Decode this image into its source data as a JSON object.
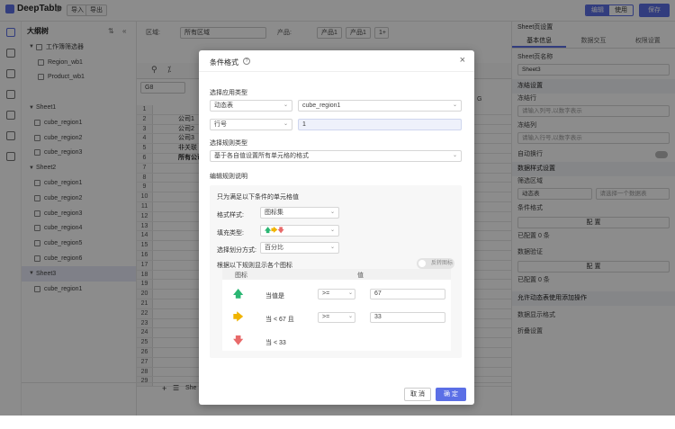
{
  "app": {
    "name": "DeepTable",
    "import": "导入",
    "export": "导出",
    "mode_edit": "编辑",
    "mode_use": "使用",
    "save": "保存"
  },
  "tree": {
    "title": "大纲树",
    "filters_group": "工作簿筛选器",
    "filters": [
      "Region_wb1",
      "Product_wb1"
    ],
    "sheets": [
      {
        "name": "Sheet1",
        "items": [
          "cube_region1",
          "cube_region2",
          "cube_region3"
        ]
      },
      {
        "name": "Sheet2",
        "items": [
          "cube_region1",
          "cube_region2",
          "cube_region3",
          "cube_region4",
          "cube_region5",
          "cube_region6"
        ]
      },
      {
        "name": "Sheet3",
        "items": [
          "cube_region1"
        ]
      }
    ]
  },
  "main": {
    "filter_region_label": "区域:",
    "filter_region_value": "所有区域",
    "filter_product_label": "产品:",
    "product_tags": [
      "产品1",
      "产品1",
      "1+"
    ],
    "col_header": "G",
    "cell_ref": "G8",
    "rows": [
      {
        "n": "1",
        "t": ""
      },
      {
        "n": "2",
        "t": "公司1"
      },
      {
        "n": "3",
        "t": "公司2"
      },
      {
        "n": "4",
        "t": "公司3"
      },
      {
        "n": "5",
        "t": "非关联"
      },
      {
        "n": "6",
        "t": "所有公司"
      },
      {
        "n": "7",
        "t": ""
      },
      {
        "n": "8",
        "t": ""
      },
      {
        "n": "9",
        "t": ""
      },
      {
        "n": "10",
        "t": ""
      },
      {
        "n": "11",
        "t": ""
      },
      {
        "n": "12",
        "t": ""
      },
      {
        "n": "13",
        "t": ""
      },
      {
        "n": "14",
        "t": ""
      },
      {
        "n": "15",
        "t": ""
      },
      {
        "n": "16",
        "t": ""
      },
      {
        "n": "17",
        "t": ""
      },
      {
        "n": "18",
        "t": ""
      },
      {
        "n": "19",
        "t": ""
      },
      {
        "n": "20",
        "t": ""
      },
      {
        "n": "21",
        "t": ""
      },
      {
        "n": "22",
        "t": ""
      },
      {
        "n": "23",
        "t": ""
      },
      {
        "n": "24",
        "t": ""
      },
      {
        "n": "25",
        "t": ""
      },
      {
        "n": "26",
        "t": ""
      },
      {
        "n": "27",
        "t": ""
      },
      {
        "n": "28",
        "t": ""
      },
      {
        "n": "29",
        "t": ""
      }
    ],
    "footer_add": "+",
    "footer_menu": "☰",
    "footer_sheet": "She"
  },
  "right": {
    "title": "Sheet页设置",
    "tabs": [
      "基本信息",
      "数据交互",
      "权限设置"
    ],
    "sheet_name_label": "Sheet页名称",
    "sheet_name": "Sheet3",
    "freeze_section": "冻结设置",
    "freeze_row": "冻结行",
    "freeze_row_ph": "请输入列号,以数字表示",
    "freeze_col": "冻结列",
    "freeze_col_ph": "请输入行号,以数字表示",
    "auto_wrap": "自动换行",
    "data_section": "数据样式设置",
    "filter_area": "筛选区域",
    "dyn_table": "动态表",
    "dyn_table_ph": "请选择一个数据表",
    "cond_format": "条件格式",
    "config": "配 置",
    "configured": "已配置 0 条",
    "data_validation": "数据验证",
    "config2": "配 置",
    "configured2": "已配置 0 条",
    "allow_dynamic": "允许动态表使用添加操作",
    "data_display": "数据显示格式",
    "fold": "折叠设置"
  },
  "dialog": {
    "title": "条件格式",
    "sec_apply": "选择应用类型",
    "apply_type": "动态表",
    "apply_target": "cube_region1",
    "index_type": "行号",
    "index_value": "1",
    "sec_rule": "选择规则类型",
    "rule_type": "基于各自值设置所有单元格的格式",
    "sec_edit": "编辑规则说明",
    "only_format": "只为满足以下条件的单元格值",
    "style_label": "格式样式:",
    "style_value": "图标集",
    "fill_label": "填充类型:",
    "split_label": "选择划分方式:",
    "split_value": "百分比",
    "show_by_rule": "根据以下规则显示各个图标",
    "reverse": "反转图标",
    "col_icon": "图标",
    "col_value": "值",
    "rules": [
      {
        "icon": "arrow-up",
        "color": "#2bb673",
        "cond": "当值是",
        "op": ">=",
        "val": "67"
      },
      {
        "icon": "arrow-right",
        "color": "#f0b400",
        "cond": "当 < 67 且",
        "op": ">=",
        "val": "33"
      },
      {
        "icon": "arrow-down",
        "color": "#e86a6a",
        "cond": "当 < 33",
        "op": "",
        "val": ""
      }
    ],
    "cancel": "取 消",
    "ok": "确 定"
  }
}
